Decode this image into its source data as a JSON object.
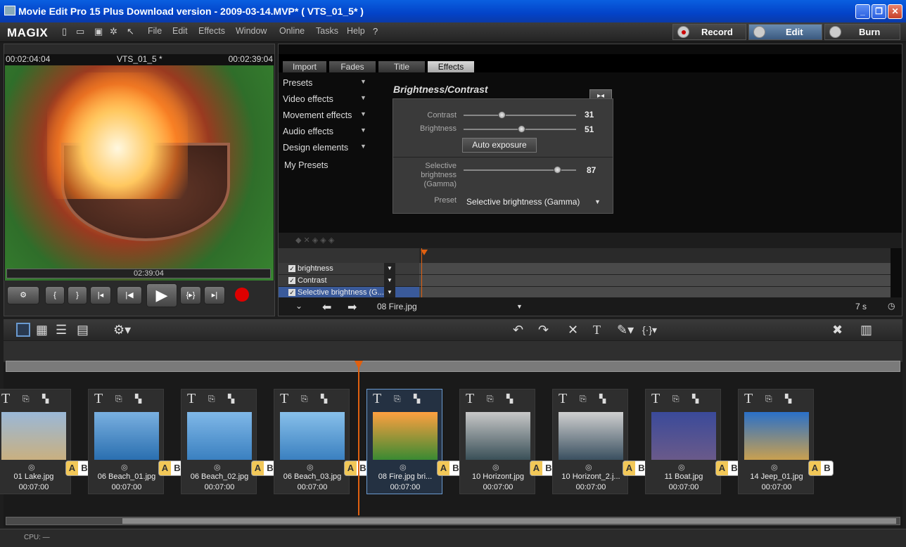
{
  "window": {
    "title": "Movie Edit Pro 15 Plus Download version - 2009-03-14.MVP* ( VTS_01_5* )"
  },
  "menu": {
    "logo": "MAGIX",
    "items": [
      "File",
      "Edit",
      "Effects",
      "Window",
      "Online",
      "Tasks",
      "Help"
    ]
  },
  "modes": {
    "record": "Record",
    "edit": "Edit",
    "burn": "Burn"
  },
  "monitor": {
    "tc_left": "00:02:04:04",
    "name": "VTS_01_5 *",
    "tc_right": "00:02:39:04",
    "scrub_tc": "02:39:04"
  },
  "tabs": [
    "Import",
    "Fades",
    "Title",
    "Effects"
  ],
  "fx_categories": [
    "Presets",
    "Video effects",
    "Movement effects",
    "Audio effects",
    "Design elements",
    "My Presets"
  ],
  "effect": {
    "title": "Brightness/Contrast",
    "contrast_label": "Contrast",
    "contrast": 31,
    "brightness_label": "Brightness",
    "brightness": 51,
    "auto_btn": "Auto exposure",
    "selective_label": "Selective brightness (Gamma)",
    "selective": 87,
    "preset_label": "Preset",
    "preset_value": "Selective brightness (Gamma)"
  },
  "keyframes": [
    "brightness",
    "Contrast",
    "Selective brightness (G..."
  ],
  "nav": {
    "clip": "08 Fire.jpg",
    "duration": "7 s"
  },
  "clips": [
    {
      "name": "01 Lake.jpg",
      "dur": "00:07:00",
      "colors": [
        "#9ab8d8",
        "#c9b080"
      ]
    },
    {
      "name": "06 Beach_01.jpg",
      "dur": "00:07:00",
      "colors": [
        "#7ab0e0",
        "#2a6fb0"
      ]
    },
    {
      "name": "06 Beach_02.jpg",
      "dur": "00:07:00",
      "colors": [
        "#80b8e8",
        "#3a80c0"
      ]
    },
    {
      "name": "06 Beach_03.jpg",
      "dur": "00:07:00",
      "colors": [
        "#88c0ea",
        "#3a80c0"
      ]
    },
    {
      "name": "08 Fire.jpg    bri...",
      "dur": "00:07:00",
      "colors": [
        "#ffa040",
        "#3a8a32"
      ]
    },
    {
      "name": "10 Horizont.jpg",
      "dur": "00:07:00",
      "colors": [
        "#c8c8c8",
        "#3a5058"
      ]
    },
    {
      "name": "10 Horizont_2.j...",
      "dur": "00:07:00",
      "colors": [
        "#d0d0d0",
        "#3a5060"
      ]
    },
    {
      "name": "11 Boat.jpg",
      "dur": "00:07:00",
      "colors": [
        "#3a4a9a",
        "#6a5a8a"
      ]
    },
    {
      "name": "14 Jeep_01.jpg",
      "dur": "00:07:00",
      "colors": [
        "#2a70c8",
        "#c9a050"
      ]
    }
  ],
  "status": {
    "cpu": "CPU: —"
  }
}
